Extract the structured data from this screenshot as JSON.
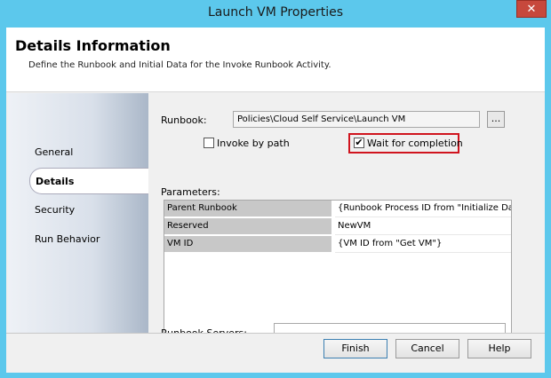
{
  "window": {
    "title": "Launch VM Properties",
    "close_glyph": "✕"
  },
  "header": {
    "title": "Details Information",
    "description": "Define the Runbook and Initial Data for the Invoke Runbook Activity."
  },
  "nav": {
    "items": [
      {
        "label": "General"
      },
      {
        "label": "Details"
      },
      {
        "label": "Security"
      },
      {
        "label": "Run Behavior"
      }
    ],
    "selected": "Details"
  },
  "details": {
    "runbook_label": "Runbook:",
    "runbook_value": "Policies\\Cloud Self Service\\Launch VM",
    "browse_label": "...",
    "invoke_by_path_label": "Invoke by path",
    "invoke_by_path_checked": false,
    "wait_label": "Wait for completion",
    "wait_checked": true,
    "check_glyph": "✔",
    "parameters_label": "Parameters:",
    "parameters": [
      {
        "name": "Parent Runbook",
        "value": "{Runbook Process ID from \"Initialize Da"
      },
      {
        "name": "Reserved",
        "value": "NewVM"
      },
      {
        "name": "VM ID",
        "value": "{VM ID from \"Get VM\"}"
      }
    ],
    "servers_label": "Runbook Servers:",
    "servers_value": ""
  },
  "footer": {
    "finish_label": "Finish",
    "cancel_label": "Cancel",
    "help_label": "Help"
  },
  "colors": {
    "title_bar": "#5cc8ec",
    "close_button": "#c7483c",
    "highlight_border": "#d0141e"
  }
}
